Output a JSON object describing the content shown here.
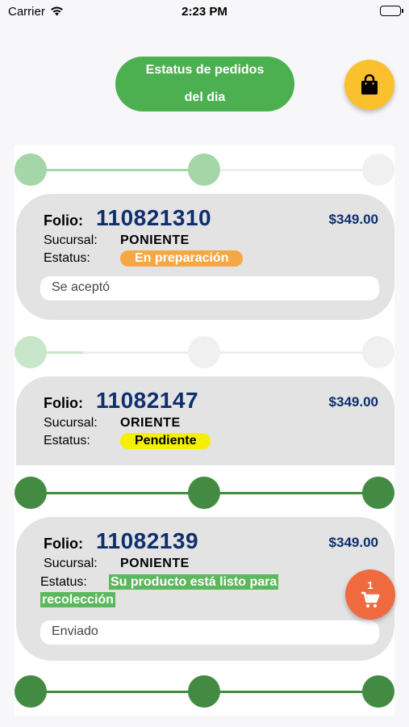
{
  "status_bar": {
    "carrier": "Carrier",
    "time": "2:23 PM",
    "wifi_icon": "wifi-icon",
    "battery_icon": "battery-icon"
  },
  "header": {
    "title": "Estatus de pedidos\ndel dia",
    "bag_icon": "shopping-bag-icon",
    "title_color": "#4caf50",
    "bag_color": "#fbc02d"
  },
  "orders": [
    {
      "folio_label": "Folio:",
      "folio": "110821310",
      "price": "$349.00",
      "sucursal_label": "Sucursal:",
      "sucursal": "PONIENTE",
      "estatus_label": "Estatus:",
      "estatus": "En preparación",
      "estatus_color": "#f4a742",
      "note": "Se aceptó",
      "progress": 0.5
    },
    {
      "folio_label": "Folio:",
      "folio": "11082147",
      "price": "$349.00",
      "sucursal_label": "Sucursal:",
      "sucursal": "ORIENTE",
      "estatus_label": "Estatus:",
      "estatus": "Pendiente",
      "estatus_color": "#f5f000",
      "progress": 0.15
    },
    {
      "folio_label": "Folio:",
      "folio": "11082139",
      "price": "$349.00",
      "sucursal_label": "Sucursal:",
      "sucursal": "PONIENTE",
      "estatus_label": "Estatus:",
      "estatus": "Su producto está listo para recolección",
      "estatus_color": "#5cb85c",
      "note": "Enviado",
      "progress": 1.0
    }
  ],
  "next_progress": 1.0,
  "cart": {
    "count": "1",
    "icon": "cart-icon",
    "color": "#ef6b3f"
  }
}
